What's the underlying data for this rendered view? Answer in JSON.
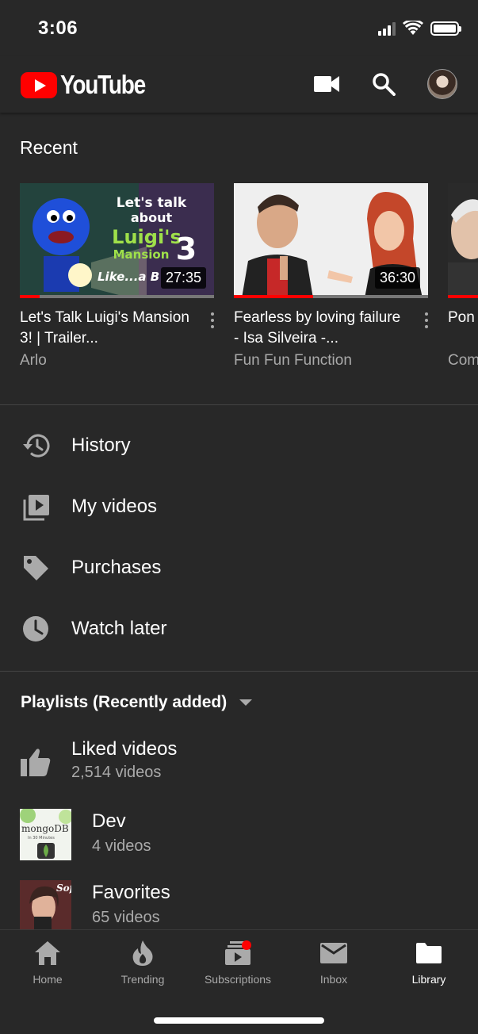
{
  "status_bar": {
    "time": "3:06"
  },
  "header": {
    "logo_text": "YouTube",
    "icons": [
      "video-camera-icon",
      "search-icon",
      "avatar"
    ]
  },
  "recent": {
    "title": "Recent",
    "videos": [
      {
        "title": "Let's Talk Luigi's Mansion 3!  |  Trailer...",
        "channel": "Arlo",
        "duration": "27:35",
        "progress": 0.1,
        "thumb_text": [
          "Let's talk",
          "about",
          "Luigi's",
          "Mansion",
          "3",
          "Like...a B"
        ]
      },
      {
        "title": "Fearless by loving failure - Isa Silveira -...",
        "channel": "Fun Fun Function",
        "duration": "36:30",
        "progress": 0.41
      },
      {
        "title": "Pon Prog",
        "channel": "Com",
        "progress": 0.9
      }
    ]
  },
  "menu": [
    {
      "label": "History",
      "icon": "history-icon"
    },
    {
      "label": "My videos",
      "icon": "my-videos-icon"
    },
    {
      "label": "Purchases",
      "icon": "tag-icon"
    },
    {
      "label": "Watch later",
      "icon": "clock-icon"
    }
  ],
  "playlists": {
    "heading": "Playlists (Recently added)",
    "items": [
      {
        "title": "Liked videos",
        "count": "2,514 videos",
        "icon": "thumbs-up-icon"
      },
      {
        "title": "Dev",
        "count": "4 videos",
        "thumb_text": [
          "mongoDB",
          "In 30 Minutes"
        ]
      },
      {
        "title": "Favorites",
        "count": "65 videos",
        "thumb_text": "Sof"
      }
    ]
  },
  "bottom_nav": [
    {
      "label": "Home",
      "icon": "home-icon"
    },
    {
      "label": "Trending",
      "icon": "flame-icon"
    },
    {
      "label": "Subscriptions",
      "icon": "subscriptions-icon"
    },
    {
      "label": "Inbox",
      "icon": "mail-icon"
    },
    {
      "label": "Library",
      "icon": "folder-icon",
      "active": true
    }
  ],
  "colors": {
    "background": "#282828",
    "accent": "#ff0000",
    "secondary_text": "#aaaaaa"
  }
}
